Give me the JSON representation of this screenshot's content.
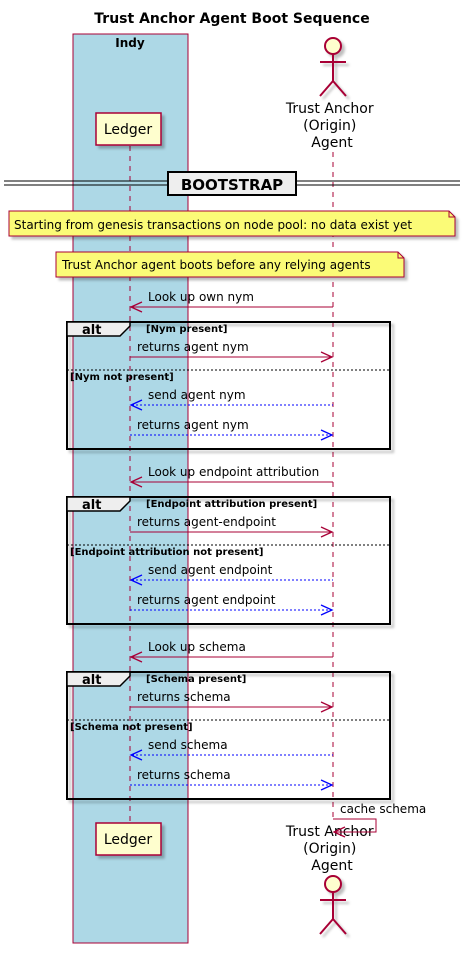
{
  "title": "Trust Anchor Agent Boot Sequence",
  "box": {
    "label": "Indy",
    "color": "#ADD8E6"
  },
  "participants": {
    "ledger": {
      "label": "Ledger"
    },
    "agent": {
      "lines": [
        "Trust Anchor",
        "(Origin)",
        "Agent"
      ]
    }
  },
  "divider": {
    "label": "BOOTSTRAP"
  },
  "notes": [
    "Starting from genesis transactions on node pool: no data exist yet",
    "Trust Anchor agent boots before any relying agents"
  ],
  "colors": {
    "request": "#A80036",
    "async": "#0000FF",
    "note": "#FBFB77"
  },
  "sequence": [
    {
      "type": "msg",
      "text": "Look up own nym",
      "dir": "left",
      "style": "solid",
      "color": "request"
    },
    {
      "type": "alt",
      "label": "alt",
      "sections": [
        {
          "guard": "[Nym present]",
          "messages": [
            {
              "text": "returns agent nym",
              "dir": "right",
              "style": "solid",
              "color": "request"
            }
          ]
        },
        {
          "guard": "[Nym not present]",
          "messages": [
            {
              "text": "send agent nym",
              "dir": "left",
              "style": "dashed",
              "color": "async"
            },
            {
              "text": "returns agent nym",
              "dir": "right",
              "style": "dashed",
              "color": "async"
            }
          ]
        }
      ]
    },
    {
      "type": "msg",
      "text": "Look up endpoint attribution",
      "dir": "left",
      "style": "solid",
      "color": "request"
    },
    {
      "type": "alt",
      "label": "alt",
      "sections": [
        {
          "guard": "[Endpoint attribution present]",
          "messages": [
            {
              "text": "returns agent-endpoint",
              "dir": "right",
              "style": "solid",
              "color": "request"
            }
          ]
        },
        {
          "guard": "[Endpoint attribution not present]",
          "messages": [
            {
              "text": "send agent endpoint",
              "dir": "left",
              "style": "dashed",
              "color": "async"
            },
            {
              "text": "returns agent endpoint",
              "dir": "right",
              "style": "dashed",
              "color": "async"
            }
          ]
        }
      ]
    },
    {
      "type": "msg",
      "text": "Look up schema",
      "dir": "left",
      "style": "solid",
      "color": "request"
    },
    {
      "type": "alt",
      "label": "alt",
      "sections": [
        {
          "guard": "[Schema present]",
          "messages": [
            {
              "text": "returns schema",
              "dir": "right",
              "style": "solid",
              "color": "request"
            }
          ]
        },
        {
          "guard": "[Schema not present]",
          "messages": [
            {
              "text": "send schema",
              "dir": "left",
              "style": "dashed",
              "color": "async"
            },
            {
              "text": "returns schema",
              "dir": "right",
              "style": "dashed",
              "color": "async"
            }
          ]
        }
      ]
    },
    {
      "type": "self",
      "text": "cache schema",
      "style": "solid",
      "color": "request"
    }
  ]
}
